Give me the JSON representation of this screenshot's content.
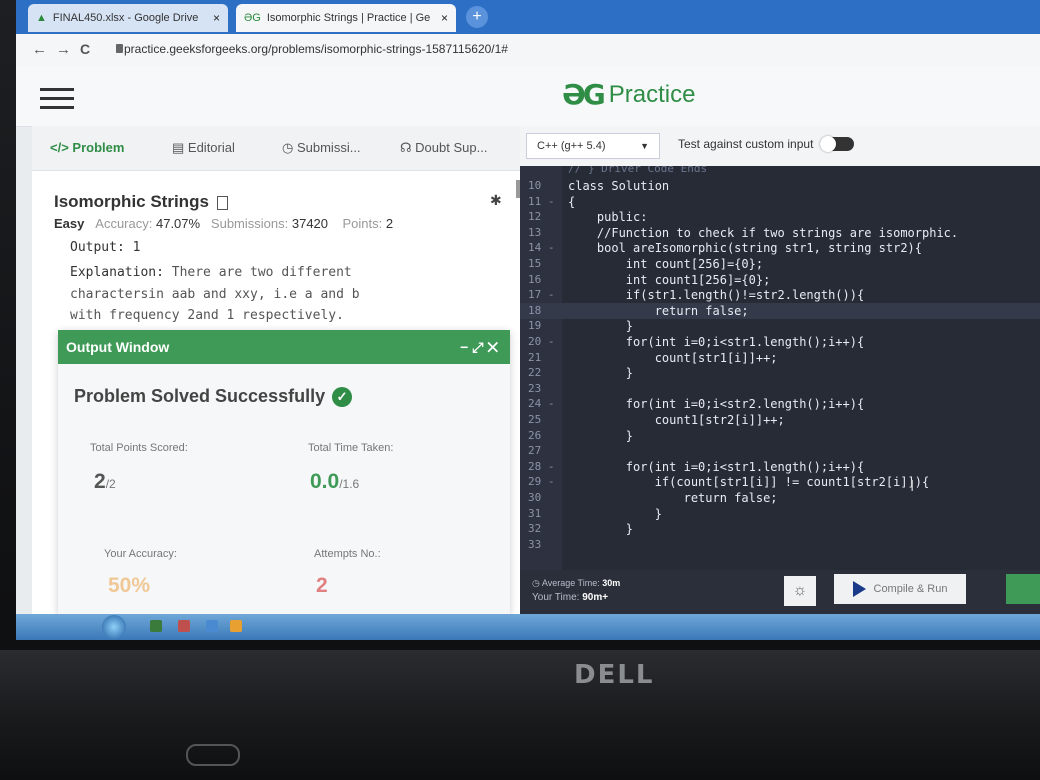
{
  "browser": {
    "tabs": [
      {
        "label": "FINAL450.xlsx - Google Drive",
        "close": "×"
      },
      {
        "label": "Isomorphic Strings | Practice | Ge",
        "close": "×"
      }
    ],
    "new_tab": "+",
    "nav": {
      "back": "←",
      "forward": "→",
      "reload": "C"
    },
    "url": "practice.geeksforgeeks.org/problems/isomorphic-strings-1587115620/1#"
  },
  "site": {
    "logo_mark": "ƏG",
    "logo_text": "Practice"
  },
  "left_tabs": [
    {
      "label": "</> Problem",
      "icon": "code-icon"
    },
    {
      "label": "Editorial",
      "icon": "editorial-icon"
    },
    {
      "label": "Submissi...",
      "icon": "clock-icon"
    },
    {
      "label": "Doubt Sup...",
      "icon": "headset-icon"
    }
  ],
  "problem": {
    "title": "Isomorphic Strings",
    "difficulty": "Easy",
    "accuracy_label": "Accuracy:",
    "accuracy": "47.07%",
    "submissions_label": "Submissions:",
    "submissions": "37420",
    "points_label": "Points:",
    "points": "2",
    "output_line": "Output: 1",
    "explanation_label": "Explanation:",
    "explanation_1": " There are two different",
    "explanation_2": "charactersin aab and xxy, i.e a and b",
    "explanation_3": "with frequency 2and 1 respectively."
  },
  "output_window": {
    "title": "Output Window",
    "controls": "− ⤢ ✕",
    "status": "Problem Solved Successfully",
    "total_points_label": "Total Points Scored:",
    "total_points": "2",
    "total_points_of": "/2",
    "total_time_label": "Total Time Taken:",
    "total_time": "0.0",
    "total_time_of": "/1.6",
    "accuracy_label": "Your Accuracy:",
    "accuracy": "50%",
    "attempts_label": "Attempts No.:",
    "attempts": "2"
  },
  "editor_header": {
    "language": "C++ (g++ 5.4)",
    "custom_input_label": "Test against custom input"
  },
  "code": {
    "top_fragment": "// } Driver Code Ends",
    "lines": [
      {
        "n": "10",
        "text": "class Solution"
      },
      {
        "n": "11 -",
        "text": "{"
      },
      {
        "n": "12",
        "text": "    public:"
      },
      {
        "n": "13",
        "text": "    //Function to check if two strings are isomorphic."
      },
      {
        "n": "14 -",
        "text": "    bool areIsomorphic(string str1, string str2){"
      },
      {
        "n": "15",
        "text": "        int count[256]={0};"
      },
      {
        "n": "16",
        "text": "        int count1[256]={0};"
      },
      {
        "n": "17 -",
        "text": "        if(str1.length()!=str2.length()){"
      },
      {
        "n": "18",
        "text": "            return false;"
      },
      {
        "n": "19",
        "text": "        }"
      },
      {
        "n": "20 -",
        "text": "        for(int i=0;i<str1.length();i++){"
      },
      {
        "n": "21",
        "text": "            count[str1[i]]++;"
      },
      {
        "n": "22",
        "text": "        }"
      },
      {
        "n": "23",
        "text": ""
      },
      {
        "n": "24 -",
        "text": "        for(int i=0;i<str2.length();i++){"
      },
      {
        "n": "25",
        "text": "            count1[str2[i]]++;"
      },
      {
        "n": "26",
        "text": "        }"
      },
      {
        "n": "27",
        "text": ""
      },
      {
        "n": "28 -",
        "text": "        for(int i=0;i<str1.length();i++){"
      },
      {
        "n": "29 -",
        "text": "            if(count[str1[i]] != count1[str2[i]]){"
      },
      {
        "n": "30",
        "text": "                return false;"
      },
      {
        "n": "31",
        "text": "            }"
      },
      {
        "n": "32",
        "text": "        }"
      },
      {
        "n": "33",
        "text": ""
      }
    ]
  },
  "editor_footer": {
    "average_time_label": "Average Time:",
    "average_time": "30m",
    "your_time_label": "Your Time:",
    "your_time": "90m+",
    "compile_run": "Compile & Run"
  },
  "hardware": {
    "brand": "DELL"
  },
  "colors": {
    "brand_green": "#2f8d46",
    "editor_bg": "#272b36",
    "browser_blue": "#2e6fc6"
  }
}
